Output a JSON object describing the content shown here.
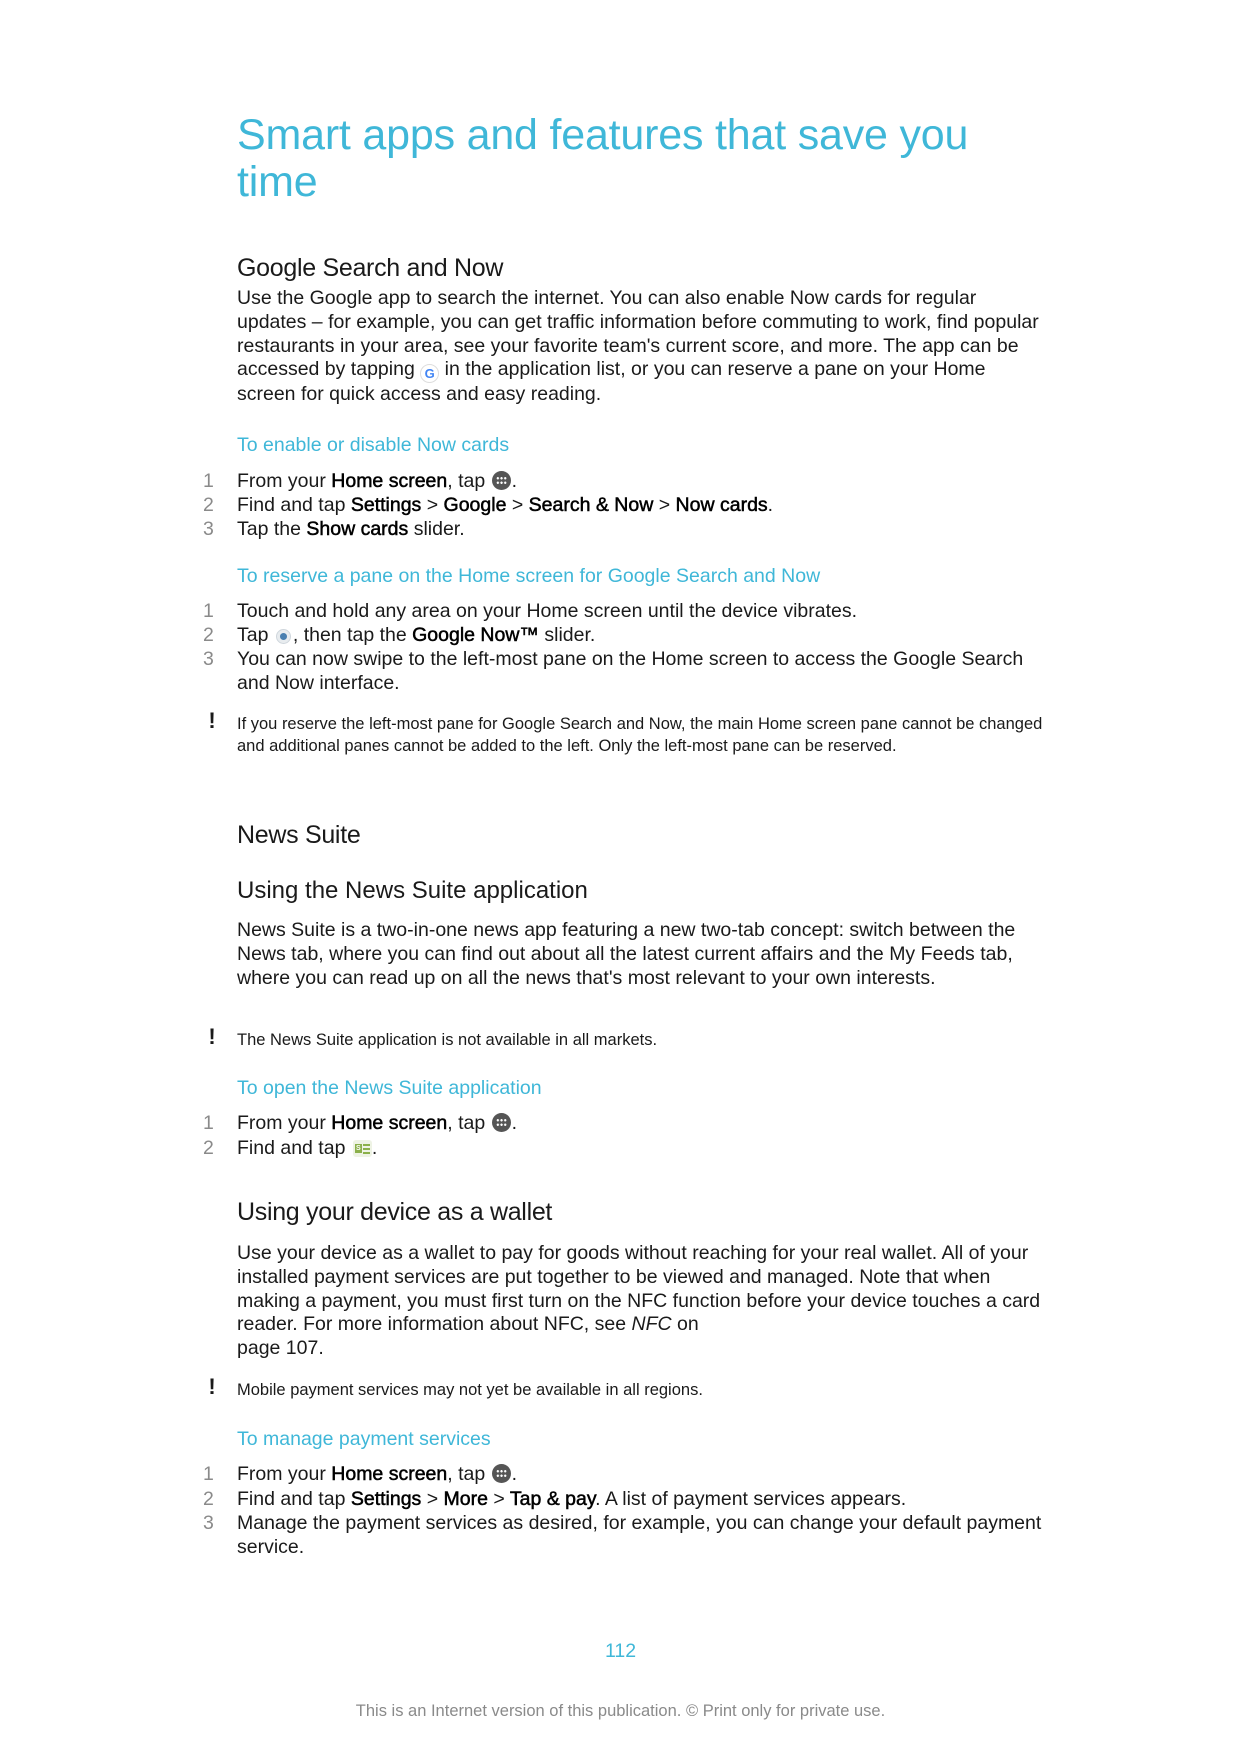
{
  "page_title": [
    "Smart apps and features that save you",
    "time"
  ],
  "sections": {
    "google": {
      "heading": "Google Search and Now",
      "body": {
        "before_icon": "Use the Google app to search the internet. You can also enable Now cards for regular updates – for example, you can get traffic information before commuting to work, find popular restaurants in your area, see your favorite team's current score, and more. The app can be accessed by tapping ",
        "icon": "google-app-icon",
        "after_icon": " in the application list, or you can reserve a pane on your Home screen for quick access and easy reading."
      },
      "procedure1": {
        "title": "To enable or disable Now cards",
        "steps": [
          {
            "num": "1",
            "parts": [
              "From your ",
              "Home screen",
              ", tap ",
              "."
            ],
            "icon": "apps-icon"
          },
          {
            "num": "2",
            "parts": [
              "Find and tap ",
              "Settings",
              " > ",
              "Google",
              " > ",
              "Search & Now",
              " > ",
              "Now cards",
              "."
            ]
          },
          {
            "num": "3",
            "parts": [
              "Tap the ",
              "Show cards",
              " slider."
            ]
          }
        ]
      },
      "procedure2": {
        "title": "To reserve a pane on the Home screen for Google Search and Now",
        "steps": [
          {
            "num": "1",
            "text": "Touch and hold any area on your Home screen until the device vibrates."
          },
          {
            "num": "2",
            "parts": [
              "Tap ",
              ", then tap the ",
              "Google Now™",
              " slider."
            ],
            "icon": "home-settings-icon"
          },
          {
            "num": "3",
            "text": "You can now swipe to the left-most pane on the Home screen to access the Google Search and Now interface."
          }
        ]
      },
      "note": "If you reserve the left-most pane for Google Search and Now, the main Home screen pane cannot be changed and additional panes cannot be added to the left. Only the left-most pane can be reserved."
    },
    "news": {
      "heading": "News Suite",
      "subheading": "Using the News Suite application",
      "body": "News Suite is a two-in-one news app featuring a new two-tab concept: switch between the News tab, where you can find out about all the latest current affairs and the My Feeds tab, where you can read up on all the news that's most relevant to your own interests.",
      "note": "The News Suite application is not available in all markets.",
      "procedure": {
        "title": "To open the News Suite application",
        "steps": [
          {
            "num": "1",
            "parts": [
              "From your ",
              "Home screen",
              ", tap ",
              "."
            ],
            "icon": "apps-icon"
          },
          {
            "num": "2",
            "parts": [
              "Find and tap ",
              "."
            ],
            "icon": "news-suite-icon"
          }
        ]
      }
    },
    "wallet": {
      "heading": "Using your device as a wallet",
      "body": {
        "before_link": "Use your device as a wallet to pay for goods without reaching for your real wallet. All of your installed payment services are put together to be viewed and managed. Note that when making a payment, you must first turn on the NFC function before your device touches a card reader. For more information about NFC, see ",
        "link": "NFC",
        "after_link": " on",
        "line_last": "page 107."
      },
      "note": "Mobile payment services may not yet be available in all regions.",
      "procedure": {
        "title": "To manage payment services",
        "steps": [
          {
            "num": "1",
            "parts": [
              "From your ",
              "Home screen",
              ", tap ",
              "."
            ],
            "icon": "apps-icon"
          },
          {
            "num": "2",
            "parts": [
              "Find and tap ",
              "Settings",
              " > ",
              "More",
              " > ",
              "Tap & pay",
              ". A list of payment services appears."
            ]
          },
          {
            "num": "3",
            "text": "Manage the payment services as desired, for example, you can change your default payment service."
          }
        ]
      }
    }
  },
  "note_icon": "!",
  "page_number": "112",
  "footer": "This is an Internet version of this publication. © Print only for private use.",
  "colors": {
    "accent": "#3fb7d8",
    "text": "#1a1a1a",
    "muted": "#8a8a8a"
  }
}
